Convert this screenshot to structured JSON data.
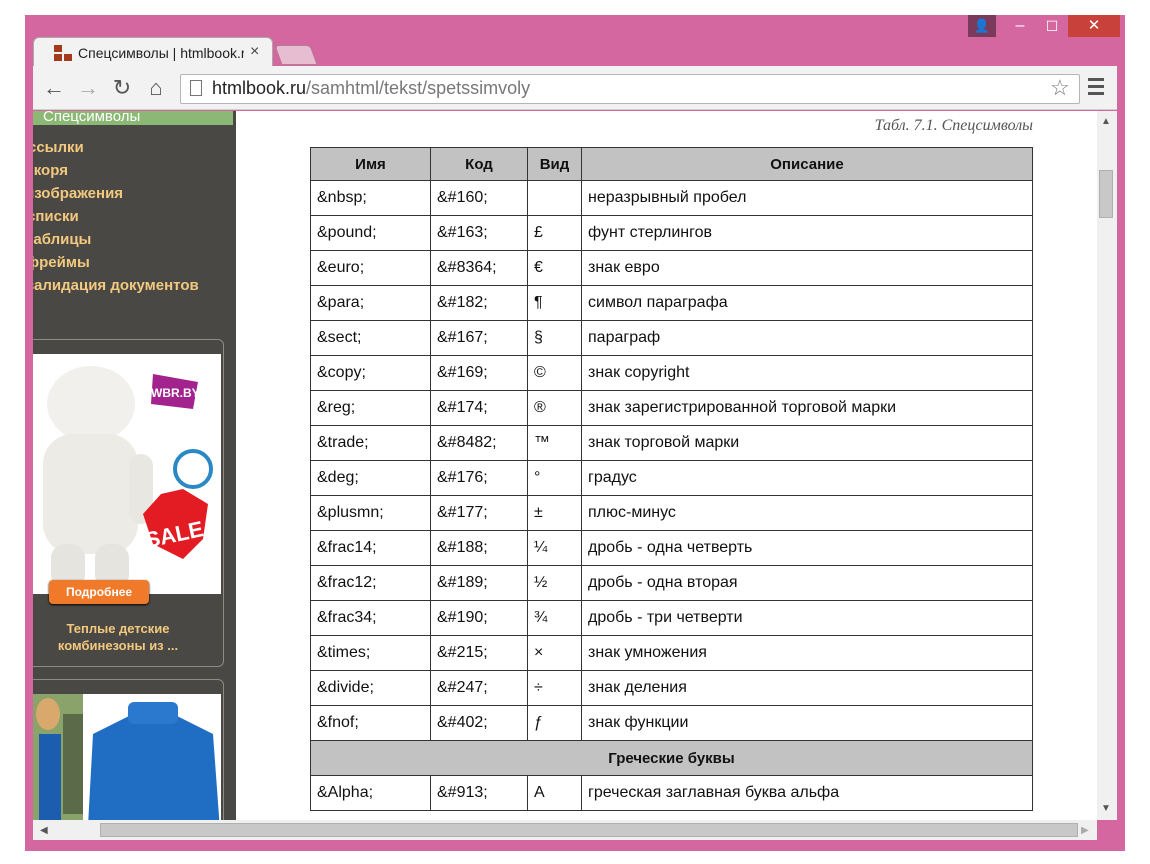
{
  "browser": {
    "tab_title": "Спецсимволы | htmlbook.ru",
    "tab_close": "×",
    "url_host": "htmlbook.ru",
    "url_path": "/samhtml/tekst/spetssimvoly",
    "window_user": "👤",
    "window_min": "–",
    "window_max": "☐",
    "window_close": "✕",
    "nav_back": "←",
    "nav_forward": "→",
    "nav_reload": "↻",
    "nav_home": "⌂",
    "star": "☆"
  },
  "sidebar": {
    "heading": "Спецсимволы",
    "links": [
      "ссылки",
      "якоря",
      "изображения",
      "списки",
      "таблицы",
      "фреймы",
      "валидация документов"
    ],
    "ad1": {
      "brand": "WBR.BY",
      "sale": "SALE",
      "button": "Подробнее",
      "caption": "Теплые детские комбинезоны из ..."
    }
  },
  "caption": "Табл. 7.1. Спецсимволы",
  "table": {
    "headers": [
      "Имя",
      "Код",
      "Вид",
      "Описание"
    ],
    "rows": [
      [
        "&nbsp;",
        "&#160;",
        " ",
        "неразрывный пробел"
      ],
      [
        "&pound;",
        "&#163;",
        "£",
        "фунт стерлингов"
      ],
      [
        "&euro;",
        "&#8364;",
        "€",
        "знак евро"
      ],
      [
        "&para;",
        "&#182;",
        "¶",
        "символ параграфа"
      ],
      [
        "&sect;",
        "&#167;",
        "§",
        "параграф"
      ],
      [
        "&copy;",
        "&#169;",
        "©",
        "знак copyright"
      ],
      [
        "&reg;",
        "&#174;",
        "®",
        "знак зарегистрированной торговой марки"
      ],
      [
        "&trade;",
        "&#8482;",
        "™",
        "знак торговой марки"
      ],
      [
        "&deg;",
        "&#176;",
        "°",
        "градус"
      ],
      [
        "&plusmn;",
        "&#177;",
        "±",
        "плюс-минус"
      ],
      [
        "&frac14;",
        "&#188;",
        "¼",
        "дробь - одна четверть"
      ],
      [
        "&frac12;",
        "&#189;",
        "½",
        "дробь - одна вторая"
      ],
      [
        "&frac34;",
        "&#190;",
        "¾",
        "дробь - три четверти"
      ],
      [
        "&times;",
        "&#215;",
        "×",
        "знак умножения"
      ],
      [
        "&divide;",
        "&#247;",
        "÷",
        "знак деления"
      ],
      [
        "&fnof;",
        "&#402;",
        "ƒ",
        "знак функции"
      ]
    ],
    "group_heading": "Греческие буквы",
    "greek_rows": [
      [
        "&Alpha;",
        "&#913;",
        "Α",
        "греческая заглавная буква альфа"
      ]
    ]
  },
  "colors": {
    "window_frame": "#d4679f",
    "sidebar_bg": "#4a4844",
    "sidebar_link": "#f2c97e",
    "sidebar_heading_bg": "#8bb874",
    "table_header_bg": "#c2c2c2",
    "close_button": "#c9413b"
  },
  "icons": {
    "favicon": "htmlbook-favicon",
    "page": "page-icon",
    "menu": "hamburger-menu-icon"
  }
}
